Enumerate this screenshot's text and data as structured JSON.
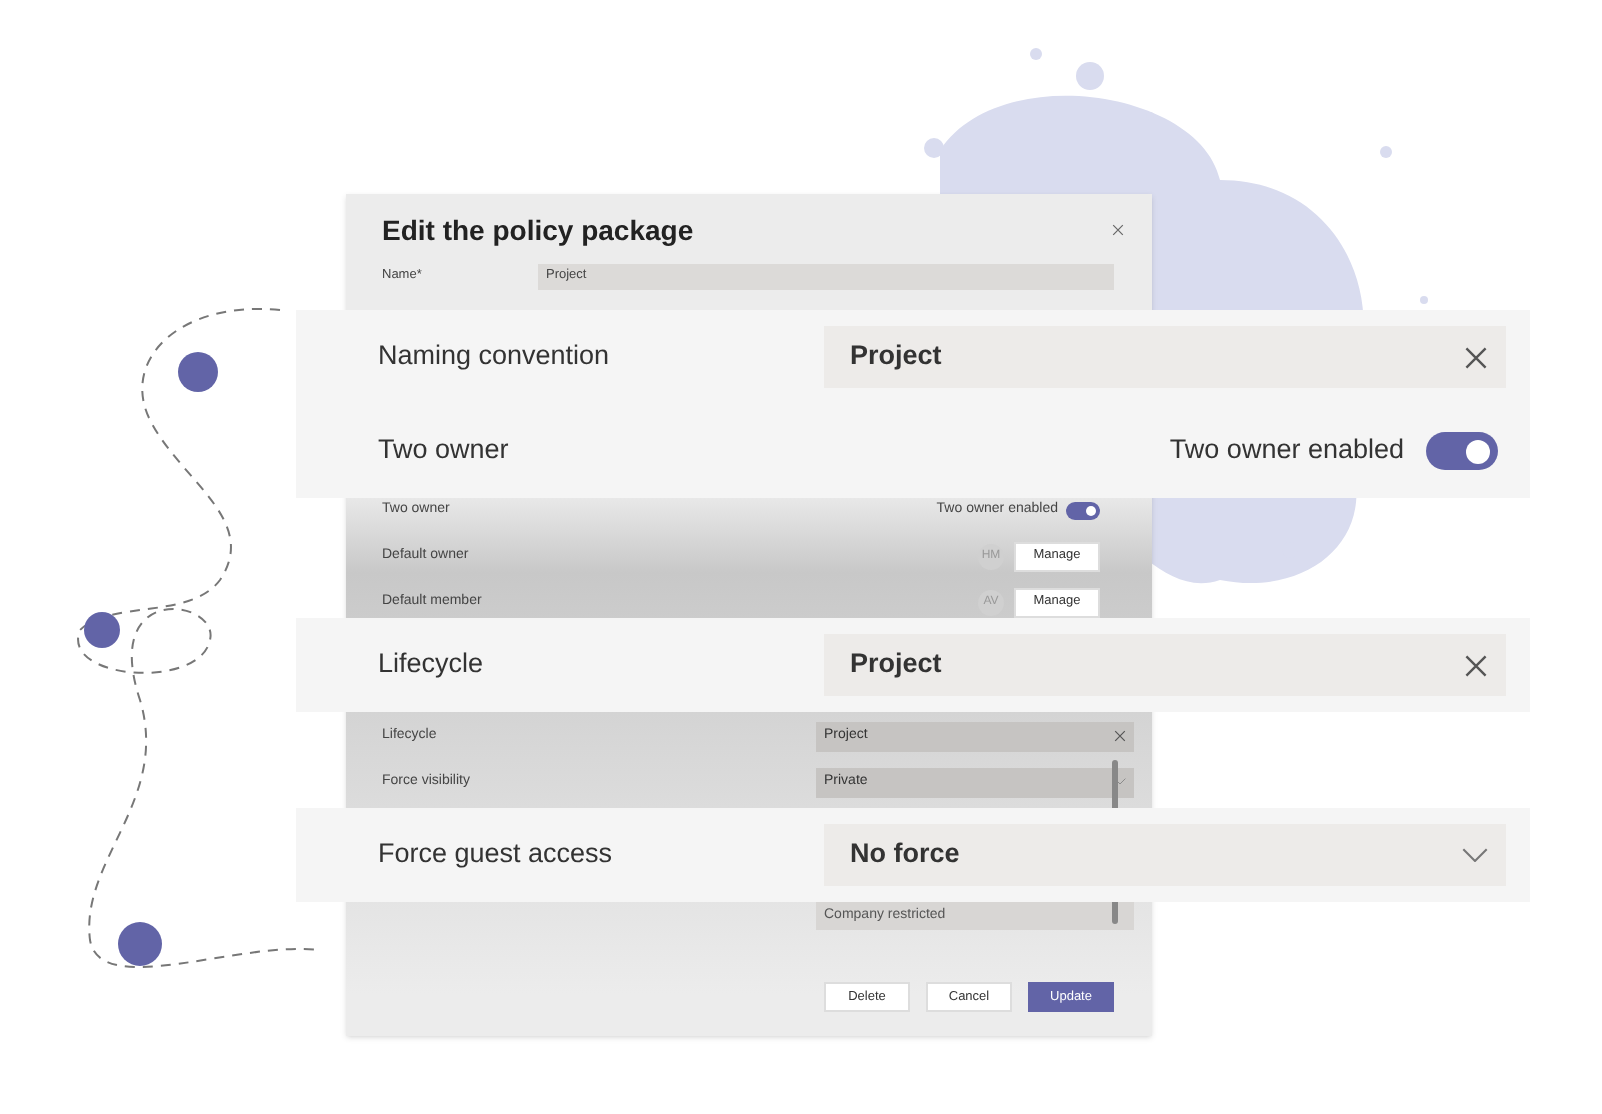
{
  "dialog": {
    "title": "Edit the policy package",
    "name_row": {
      "label": "Name*",
      "value": "Project"
    },
    "upper_rows": [
      {
        "kind": "toggle",
        "label": "Two owner",
        "toggle_label": "Two owner enabled",
        "on": true
      },
      {
        "kind": "manage",
        "label": "Default owner",
        "initials": "HM",
        "button": "Manage"
      },
      {
        "kind": "manage",
        "label": "Default member",
        "initials": "AV",
        "button": "Manage"
      }
    ],
    "lower_rows": [
      {
        "kind": "clear",
        "label": "Lifecycle",
        "value": "Project"
      },
      {
        "kind": "dropdown",
        "label": "Force visibility",
        "value": "Private"
      }
    ],
    "partial_value": "Company restricted",
    "buttons": [
      {
        "label": "Delete",
        "kind": "default"
      },
      {
        "label": "Cancel",
        "kind": "default"
      },
      {
        "label": "Update",
        "kind": "primary"
      }
    ]
  },
  "callouts": [
    {
      "rows": [
        {
          "kind": "clear",
          "label": "Naming convention",
          "value": "Project"
        },
        {
          "kind": "toggle",
          "label": "Two owner",
          "toggle_label": "Two owner enabled",
          "on": true
        }
      ]
    },
    {
      "rows": [
        {
          "kind": "clear",
          "label": "Lifecycle",
          "value": "Project"
        }
      ]
    },
    {
      "rows": [
        {
          "kind": "dropdown",
          "label": "Force guest access",
          "value": "No force"
        }
      ]
    }
  ]
}
